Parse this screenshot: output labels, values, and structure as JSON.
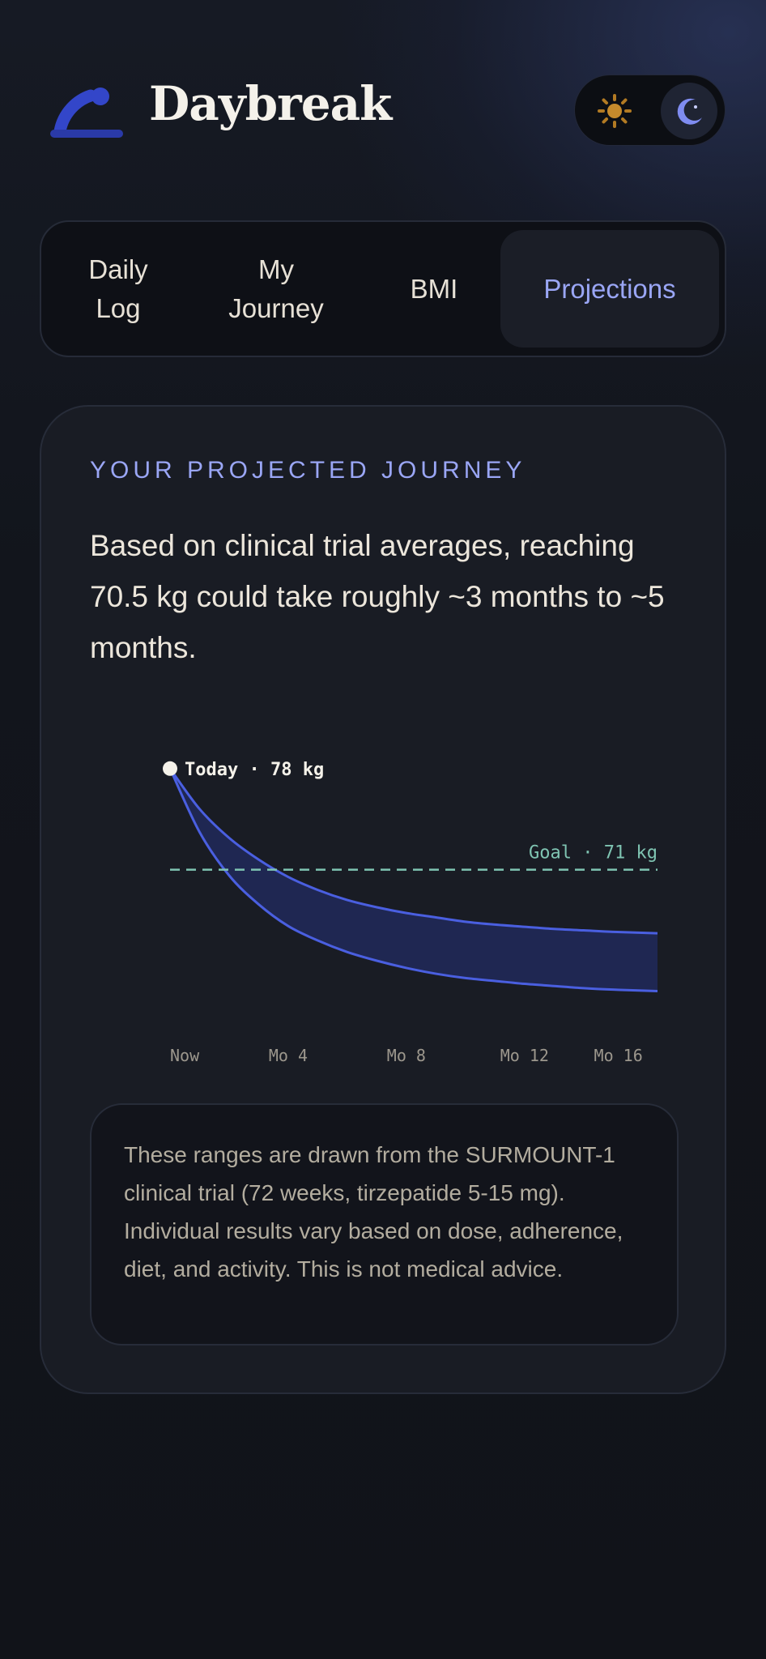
{
  "app": {
    "title": "Daybreak"
  },
  "theme_toggle": {
    "sun_icon": "sun-icon",
    "moon_icon": "moon-icon",
    "active": "dark"
  },
  "tabs": [
    {
      "line1": "Daily",
      "line2": "Log",
      "active": false
    },
    {
      "line1": "My",
      "line2": "Journey",
      "active": false
    },
    {
      "line1": "BMI",
      "line2": "",
      "active": false
    },
    {
      "line1": "Projections",
      "line2": "",
      "active": true
    }
  ],
  "projection": {
    "eyebrow": "YOUR PROJECTED JOURNEY",
    "summary": "Based on clinical trial averages, reaching 70.5 kg could take roughly ~3 months to ~5 months.",
    "disclaimer": "These ranges are drawn from the SURMOUNT-1 clinical trial (72 weeks, tirzepatide 5-15 mg). Individual results vary based on dose, adherence, diet, and activity. This is not medical advice."
  },
  "chart_data": {
    "type": "area",
    "x_tick_labels": [
      "Now",
      "Mo 4",
      "Mo 8",
      "Mo 12",
      "Mo 16"
    ],
    "x_ticks": [
      0,
      4,
      8,
      12,
      16
    ],
    "x_range": [
      0,
      16.5
    ],
    "y_range": [
      61,
      79.5
    ],
    "start_label": "Today · 78 kg",
    "start_value": 78,
    "goal_label": "Goal · 71 kg",
    "goal_value": 71,
    "x": [
      0,
      1,
      2,
      3,
      4,
      5,
      6,
      7,
      8,
      9,
      10,
      11,
      12,
      13,
      14,
      15,
      16.5
    ],
    "upper": [
      78,
      75.2,
      73.2,
      71.7,
      70.5,
      69.6,
      68.9,
      68.4,
      68,
      67.7,
      67.4,
      67.2,
      67.05,
      66.9,
      66.8,
      66.7,
      66.6
    ],
    "lower": [
      78,
      73.6,
      70.6,
      68.6,
      67.1,
      66.1,
      65.3,
      64.7,
      64.2,
      63.8,
      63.5,
      63.3,
      63.1,
      62.95,
      62.8,
      62.7,
      62.6
    ],
    "colors": {
      "band": "#1f2752",
      "band_stroke": "#4a5fe0",
      "goal": "#7fc4b2",
      "marker": "#f5f2ea"
    },
    "grid": false
  }
}
